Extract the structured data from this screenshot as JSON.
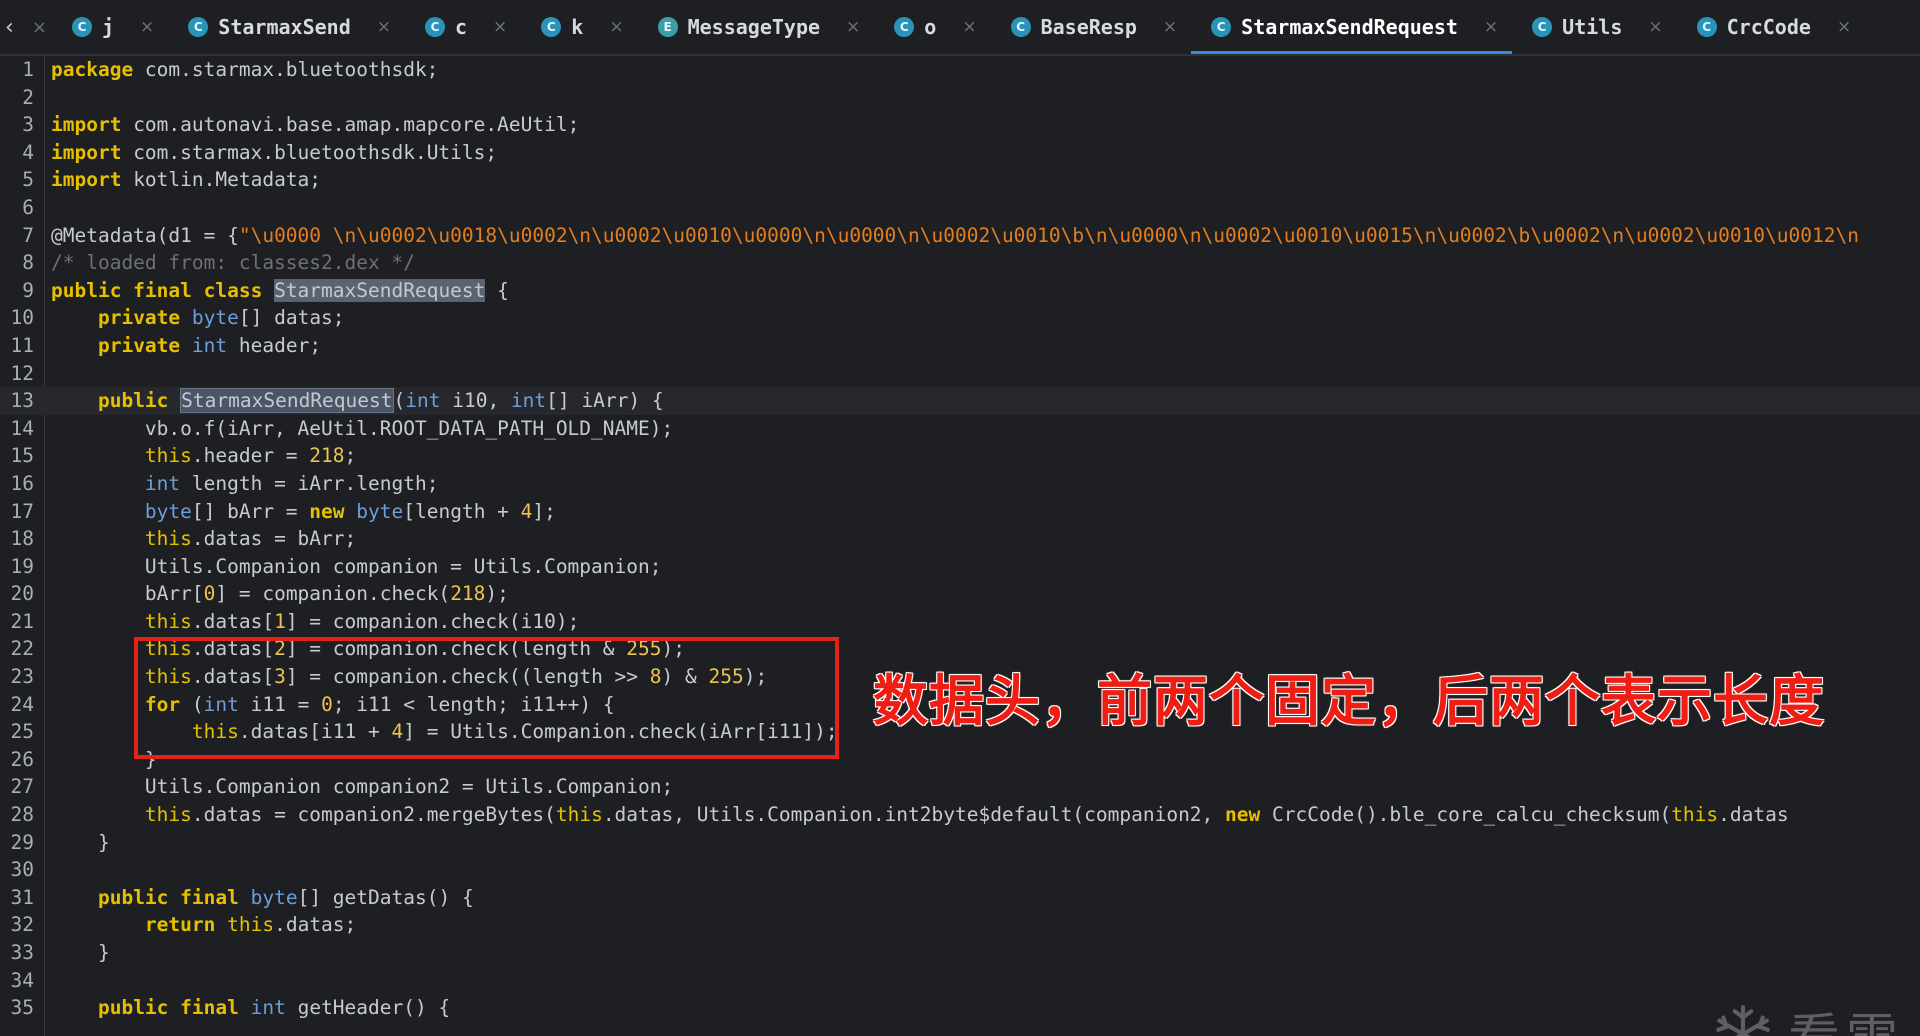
{
  "tabs": [
    {
      "label": "j",
      "icon": "class-icon",
      "active": false
    },
    {
      "label": "StarmaxSend",
      "icon": "class-icon",
      "active": false
    },
    {
      "label": "c",
      "icon": "class-icon",
      "active": false
    },
    {
      "label": "k",
      "icon": "class-icon",
      "active": false
    },
    {
      "label": "MessageType",
      "icon": "enum-icon",
      "active": false
    },
    {
      "label": "o",
      "icon": "class-icon",
      "active": false
    },
    {
      "label": "BaseResp",
      "icon": "class-icon",
      "active": false
    },
    {
      "label": "StarmaxSendRequest",
      "icon": "class-icon",
      "active": true
    },
    {
      "label": "Utils",
      "icon": "class-icon",
      "active": false
    },
    {
      "label": "CrcCode",
      "icon": "class-icon",
      "active": false
    }
  ],
  "colors": {
    "keyword": "#e6c000",
    "type": "#6d9ed8",
    "string": "#e37e20",
    "number": "#eec34e",
    "comment": "#6d7077",
    "annotation_red": "#e2231a",
    "active_tab_underline": "#3b87e5"
  },
  "code_lines": [
    {
      "n": "1",
      "parts": [
        [
          "kw",
          "package"
        ],
        [
          "p",
          " com.starmax.bluetoothsdk;"
        ]
      ]
    },
    {
      "n": "2",
      "parts": []
    },
    {
      "n": "3",
      "parts": [
        [
          "kw",
          "import"
        ],
        [
          "p",
          " com.autonavi.base.amap.mapcore.AeUtil;"
        ]
      ]
    },
    {
      "n": "4",
      "parts": [
        [
          "kw",
          "import"
        ],
        [
          "p",
          " com.starmax.bluetoothsdk.Utils;"
        ]
      ]
    },
    {
      "n": "5",
      "parts": [
        [
          "kw",
          "import"
        ],
        [
          "p",
          " kotlin.Metadata;"
        ]
      ]
    },
    {
      "n": "6",
      "parts": []
    },
    {
      "n": "7",
      "parts": [
        [
          "p",
          "@Metadata(d1 = {"
        ],
        [
          "str",
          "\"\\u0000 \\n\\u0002\\u0018\\u0002\\n\\u0002\\u0010\\u0000\\n\\u0000\\n\\u0002\\u0010\\b\\n\\u0000\\n\\u0002\\u0010\\u0015\\n\\u0002\\b\\u0002\\n\\u0002\\u0010\\u0012\\n"
        ]
      ]
    },
    {
      "n": "8",
      "parts": [
        [
          "cmt",
          "/* loaded from: classes2.dex */"
        ]
      ]
    },
    {
      "n": "9",
      "parts": [
        [
          "kw",
          "public final class"
        ],
        [
          "p",
          " "
        ],
        [
          "hl",
          "StarmaxSendRequest"
        ],
        [
          "p",
          " {"
        ]
      ]
    },
    {
      "n": "10",
      "parts": [
        [
          "p",
          "    "
        ],
        [
          "kw",
          "private"
        ],
        [
          "p",
          " "
        ],
        [
          "ty",
          "byte"
        ],
        [
          "p",
          "[] datas;"
        ]
      ]
    },
    {
      "n": "11",
      "parts": [
        [
          "p",
          "    "
        ],
        [
          "kw",
          "private"
        ],
        [
          "p",
          " "
        ],
        [
          "ty",
          "int"
        ],
        [
          "p",
          " header;"
        ]
      ]
    },
    {
      "n": "12",
      "parts": []
    },
    {
      "n": "13",
      "current": true,
      "parts": [
        [
          "p",
          "    "
        ],
        [
          "kw",
          "public"
        ],
        [
          "p",
          " "
        ],
        [
          "hl2",
          "StarmaxSendRequest"
        ],
        [
          "p",
          "("
        ],
        [
          "ty",
          "int"
        ],
        [
          "p",
          " i10, "
        ],
        [
          "ty",
          "int"
        ],
        [
          "p",
          "[] iArr) {"
        ]
      ]
    },
    {
      "n": "14",
      "parts": [
        [
          "p",
          "        vb.o.f(iArr, AeUtil.ROOT_DATA_PATH_OLD_NAME);"
        ]
      ]
    },
    {
      "n": "15",
      "parts": [
        [
          "p",
          "        "
        ],
        [
          "kw2",
          "this"
        ],
        [
          "p",
          ".header = "
        ],
        [
          "num",
          "218"
        ],
        [
          "p",
          ";"
        ]
      ]
    },
    {
      "n": "16",
      "parts": [
        [
          "p",
          "        "
        ],
        [
          "ty",
          "int"
        ],
        [
          "p",
          " length = iArr.length;"
        ]
      ]
    },
    {
      "n": "17",
      "parts": [
        [
          "p",
          "        "
        ],
        [
          "ty",
          "byte"
        ],
        [
          "p",
          "[] bArr = "
        ],
        [
          "kw",
          "new"
        ],
        [
          "p",
          " "
        ],
        [
          "ty",
          "byte"
        ],
        [
          "p",
          "[length + "
        ],
        [
          "num",
          "4"
        ],
        [
          "p",
          "];"
        ]
      ]
    },
    {
      "n": "18",
      "parts": [
        [
          "p",
          "        "
        ],
        [
          "kw2",
          "this"
        ],
        [
          "p",
          ".datas = bArr;"
        ]
      ]
    },
    {
      "n": "19",
      "parts": [
        [
          "p",
          "        Utils.Companion companion = Utils.Companion;"
        ]
      ]
    },
    {
      "n": "20",
      "parts": [
        [
          "p",
          "        bArr["
        ],
        [
          "num",
          "0"
        ],
        [
          "p",
          "] = companion.check("
        ],
        [
          "num",
          "218"
        ],
        [
          "p",
          ");"
        ]
      ]
    },
    {
      "n": "21",
      "parts": [
        [
          "p",
          "        "
        ],
        [
          "kw2",
          "this"
        ],
        [
          "p",
          ".datas["
        ],
        [
          "num",
          "1"
        ],
        [
          "p",
          "] = companion.check(i10);"
        ]
      ]
    },
    {
      "n": "22",
      "parts": [
        [
          "p",
          "        "
        ],
        [
          "kw2",
          "this"
        ],
        [
          "p",
          ".datas["
        ],
        [
          "num",
          "2"
        ],
        [
          "p",
          "] = companion.check(length & "
        ],
        [
          "num",
          "255"
        ],
        [
          "p",
          ");"
        ]
      ]
    },
    {
      "n": "23",
      "parts": [
        [
          "p",
          "        "
        ],
        [
          "kw2",
          "this"
        ],
        [
          "p",
          ".datas["
        ],
        [
          "num",
          "3"
        ],
        [
          "p",
          "] = companion.check((length >> "
        ],
        [
          "num",
          "8"
        ],
        [
          "p",
          ") & "
        ],
        [
          "num",
          "255"
        ],
        [
          "p",
          ");"
        ]
      ]
    },
    {
      "n": "24",
      "parts": [
        [
          "p",
          "        "
        ],
        [
          "kw",
          "for"
        ],
        [
          "p",
          " ("
        ],
        [
          "ty",
          "int"
        ],
        [
          "p",
          " i11 = "
        ],
        [
          "num",
          "0"
        ],
        [
          "p",
          "; i11 < length; i11++) {"
        ]
      ]
    },
    {
      "n": "25",
      "parts": [
        [
          "p",
          "            "
        ],
        [
          "kw2",
          "this"
        ],
        [
          "p",
          ".datas[i11 + "
        ],
        [
          "num",
          "4"
        ],
        [
          "p",
          "] = Utils.Companion.check(iArr[i11]);"
        ]
      ]
    },
    {
      "n": "26",
      "parts": [
        [
          "p",
          "        }"
        ]
      ]
    },
    {
      "n": "27",
      "parts": [
        [
          "p",
          "        Utils.Companion companion2 = Utils.Companion;"
        ]
      ]
    },
    {
      "n": "28",
      "parts": [
        [
          "p",
          "        "
        ],
        [
          "kw2",
          "this"
        ],
        [
          "p",
          ".datas = companion2.mergeBytes("
        ],
        [
          "kw2",
          "this"
        ],
        [
          "p",
          ".datas, Utils.Companion.int2byte$default(companion2, "
        ],
        [
          "kw",
          "new"
        ],
        [
          "p",
          " CrcCode().ble_core_calcu_checksum("
        ],
        [
          "kw2",
          "this"
        ],
        [
          "p",
          ".datas"
        ]
      ]
    },
    {
      "n": "29",
      "parts": [
        [
          "p",
          "    }"
        ]
      ]
    },
    {
      "n": "30",
      "parts": []
    },
    {
      "n": "31",
      "parts": [
        [
          "p",
          "    "
        ],
        [
          "kw",
          "public final"
        ],
        [
          "p",
          " "
        ],
        [
          "ty",
          "byte"
        ],
        [
          "p",
          "[] getDatas() {"
        ]
      ]
    },
    {
      "n": "32",
      "parts": [
        [
          "p",
          "        "
        ],
        [
          "kw",
          "return"
        ],
        [
          "p",
          " "
        ],
        [
          "kw2",
          "this"
        ],
        [
          "p",
          ".datas;"
        ]
      ]
    },
    {
      "n": "33",
      "parts": [
        [
          "p",
          "    }"
        ]
      ]
    },
    {
      "n": "34",
      "parts": []
    },
    {
      "n": "35",
      "parts": [
        [
          "p",
          "    "
        ],
        [
          "kw",
          "public final"
        ],
        [
          "p",
          " "
        ],
        [
          "ty",
          "int"
        ],
        [
          "p",
          " getHeader() {"
        ]
      ]
    }
  ],
  "annotation": {
    "text": "数据头，前两个固定，后两个表示长度"
  },
  "watermark": {
    "text": "看雪"
  }
}
